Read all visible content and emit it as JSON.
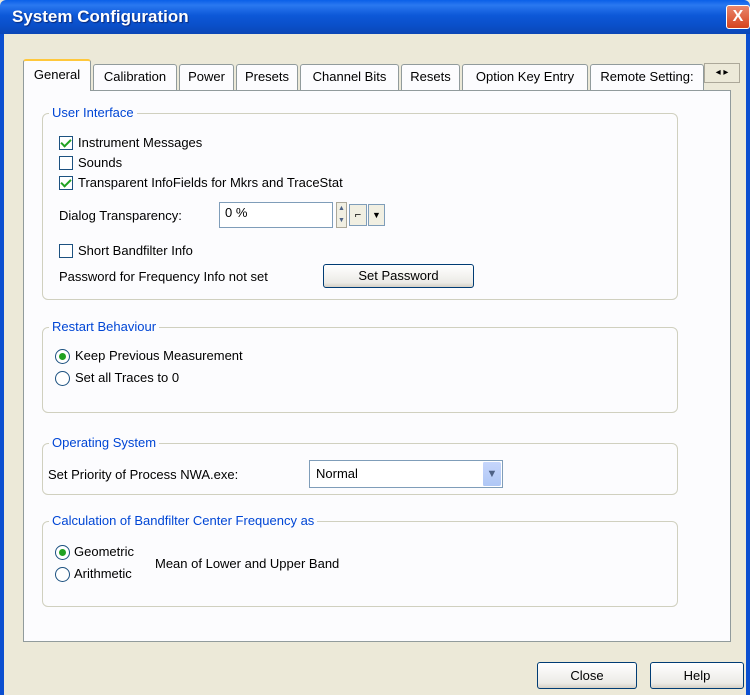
{
  "window": {
    "title": "System Configuration",
    "close_glyph": "X"
  },
  "tabs": [
    {
      "label": "General"
    },
    {
      "label": "Calibration"
    },
    {
      "label": "Power"
    },
    {
      "label": "Presets"
    },
    {
      "label": "Channel Bits"
    },
    {
      "label": "Resets"
    },
    {
      "label": "Option Key Entry"
    },
    {
      "label": "Remote Setting:"
    }
  ],
  "tab_scroll": {
    "glyphs": "◂ ▸"
  },
  "user_interface": {
    "title": "User Interface",
    "instrument_messages": "Instrument Messages",
    "sounds": "Sounds",
    "transparent_infofields": "Transparent InfoFields for Mkrs and TraceStat",
    "dialog_transparency_label": "Dialog Transparency:",
    "dialog_transparency_value": "0 %",
    "short_bandfilter": "Short Bandfilter Info",
    "password_status": "Password for Frequency Info not set",
    "set_password_button": "Set Password"
  },
  "restart": {
    "title": "Restart Behaviour",
    "keep_previous": "Keep Previous Measurement",
    "set_all_traces": "Set all Traces to 0"
  },
  "os": {
    "title": "Operating System",
    "priority_label": "Set Priority of Process NWA.exe:",
    "priority_value": "Normal"
  },
  "calc": {
    "title": "Calculation of Bandfilter Center Frequency as",
    "geometric": "Geometric",
    "arithmetic": "Arithmetic",
    "mean_label": "Mean of Lower and Upper Band"
  },
  "footer": {
    "close_button": "Close",
    "help_button": "Help"
  }
}
